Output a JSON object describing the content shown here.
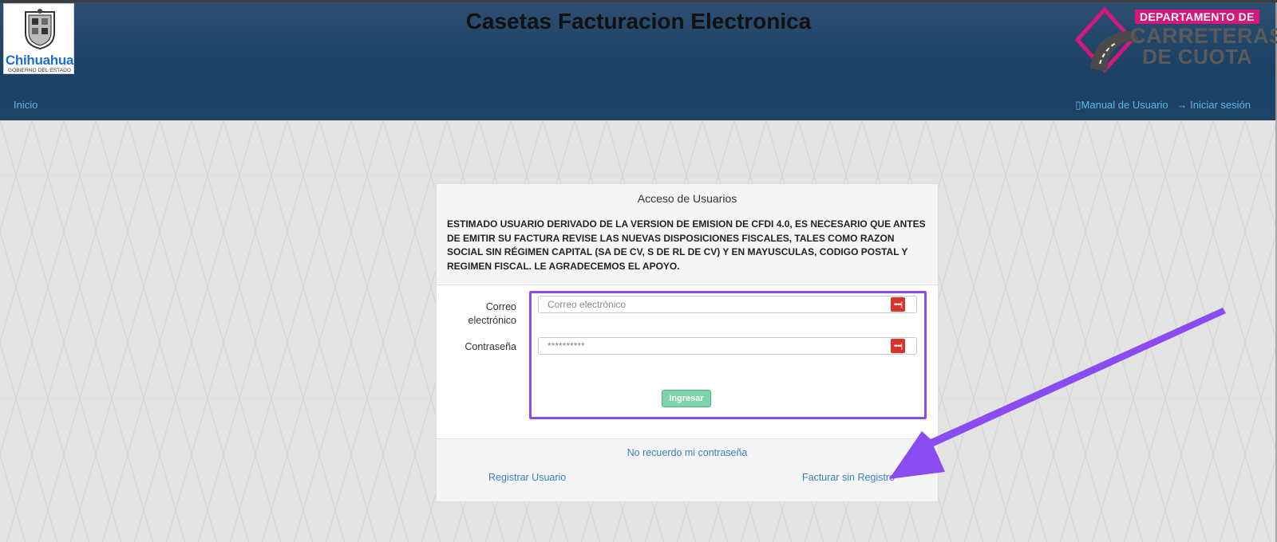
{
  "header": {
    "title": "Casetas Facturacion Electronica",
    "logo_left": {
      "name": "Chihuahua",
      "subtitle": "GOBIERNO DEL ESTADO"
    },
    "logo_right": {
      "line1": "DEPARTAMENTO DE",
      "line2": "CARRETERAS",
      "line3": "DE CUOTA"
    }
  },
  "nav": {
    "home": "Inicio",
    "manual": "▯Manual de Usuario",
    "login_icon": "→",
    "login": "Iniciar sesión"
  },
  "panel": {
    "title": "Acceso de Usuarios",
    "notice": "ESTIMADO USUARIO DERIVADO DE LA VERSION DE EMISION DE CFDI 4.0, ES NECESARIO QUE ANTES DE EMITIR SU FACTURA REVISE LAS NUEVAS DISPOSICIONES FISCALES, TALES COMO RAZON SOCIAL SIN RÉGIMEN CAPITAL (SA DE CV, S DE RL DE CV) Y EN MAYUSCULAS, CODIGO POSTAL Y REGIMEN FISCAL. LE AGRADECEMOS EL APOYO.",
    "email_label": "Correo electrónico",
    "email_placeholder": "Correo electrónico",
    "password_label": "Contraseña",
    "password_placeholder": "**********",
    "key_icon": "••••|",
    "submit": "Ingresar",
    "forgot": "No recuerdo mi contraseña",
    "register": "Registrar Usuario",
    "no_register": "Facturar sin Registro"
  },
  "colors": {
    "header_bg": "#1d4367",
    "link": "#3a7ec0",
    "nav_link": "#5cb8e6",
    "submit_bg": "#7dd4a9",
    "highlight": "#8a4cf0",
    "key_button": "#d9342b"
  }
}
